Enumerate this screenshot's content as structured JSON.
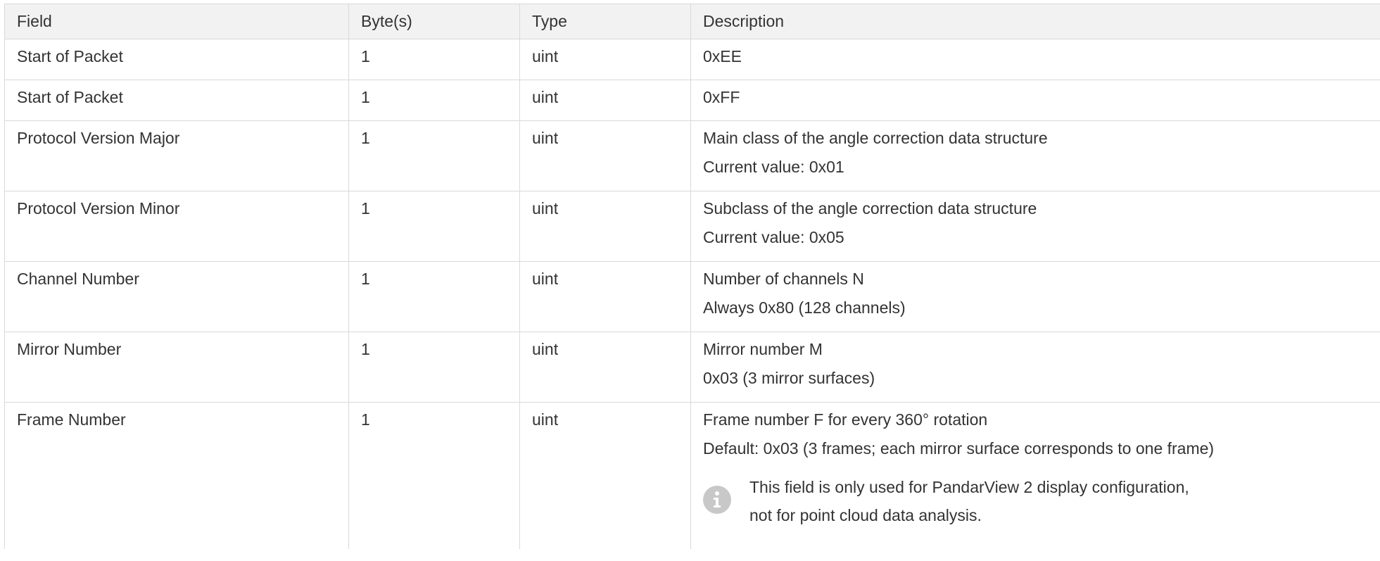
{
  "table": {
    "headers": [
      "Field",
      "Byte(s)",
      "Type",
      "Description"
    ],
    "rows": [
      {
        "field": "Start of Packet",
        "bytes": "1",
        "type": "uint",
        "desc": [
          "0xEE"
        ]
      },
      {
        "field": "Start of Packet",
        "bytes": "1",
        "type": "uint",
        "desc": [
          "0xFF"
        ]
      },
      {
        "field": "Protocol Version Major",
        "bytes": "1",
        "type": "uint",
        "desc": [
          "Main class of the angle correction data structure",
          "Current value: 0x01"
        ]
      },
      {
        "field": "Protocol Version Minor",
        "bytes": "1",
        "type": "uint",
        "desc": [
          "Subclass of the angle correction data structure",
          "Current value: 0x05"
        ]
      },
      {
        "field": "Channel Number",
        "bytes": "1",
        "type": "uint",
        "desc": [
          "Number of channels N",
          "Always 0x80 (128 channels)"
        ]
      },
      {
        "field": "Mirror Number",
        "bytes": "1",
        "type": "uint",
        "desc": [
          "Mirror number M",
          "0x03 (3 mirror surfaces)"
        ]
      },
      {
        "field": "Frame Number",
        "bytes": "1",
        "type": "uint",
        "desc": [
          "Frame number F for every 360° rotation",
          "Default: 0x03 (3 frames; each mirror surface corresponds to one frame)"
        ],
        "note": {
          "icon": "info-icon",
          "lines": [
            "This field is only used for PandarView 2 display configuration,",
            "not for point cloud data analysis."
          ]
        }
      }
    ]
  }
}
